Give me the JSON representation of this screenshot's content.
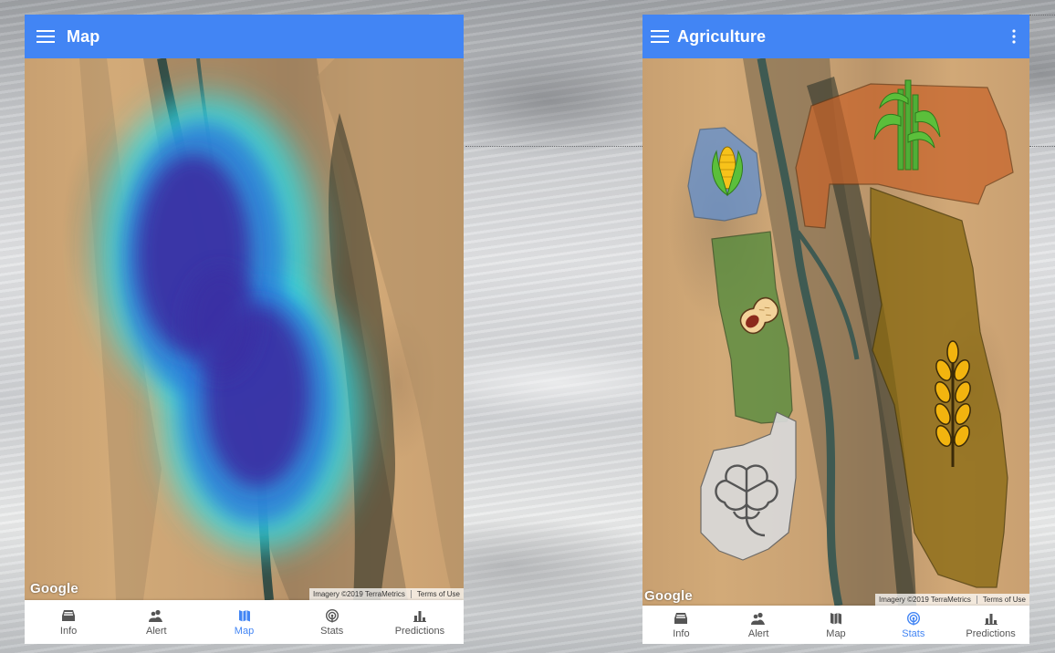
{
  "left_screen": {
    "title": "Map",
    "icons": {
      "menu": "hamburger-menu-icon"
    },
    "map": {
      "logo": "Google",
      "imagery": "Imagery ©2019 TerraMetrics",
      "terms": "Terms of Use",
      "overlay": "heatmap"
    },
    "nav": [
      {
        "label": "Info",
        "icon": "inbox-icon",
        "active": false
      },
      {
        "label": "Alert",
        "icon": "people-icon",
        "active": false
      },
      {
        "label": "Map",
        "icon": "map-icon",
        "active": true
      },
      {
        "label": "Stats",
        "icon": "signal-icon",
        "active": false
      },
      {
        "label": "Predictions",
        "icon": "bar-chart-icon",
        "active": false
      }
    ]
  },
  "right_screen": {
    "title": "Agriculture",
    "icons": {
      "menu": "hamburger-menu-icon",
      "more": "more-vertical-icon"
    },
    "map": {
      "logo": "Google",
      "imagery": "Imagery ©2019 TerraMetrics",
      "terms": "Terms of Use",
      "crop_zones": [
        {
          "crop": "corn-icon",
          "color": "#5b8fd6"
        },
        {
          "crop": "sugarcane-icon",
          "color": "#c8642a"
        },
        {
          "crop": "peanut-icon",
          "color": "#4f8a3a"
        },
        {
          "crop": "wheat-icon",
          "color": "#8a6a12"
        },
        {
          "crop": "cotton-icon",
          "color": "#d9d9d9"
        }
      ]
    },
    "nav": [
      {
        "label": "Info",
        "icon": "inbox-icon",
        "active": false
      },
      {
        "label": "Alert",
        "icon": "people-icon",
        "active": false
      },
      {
        "label": "Map",
        "icon": "map-icon",
        "active": false
      },
      {
        "label": "Stats",
        "icon": "signal-icon",
        "active": true
      },
      {
        "label": "Predictions",
        "icon": "bar-chart-icon",
        "active": false
      }
    ]
  },
  "colors": {
    "appbar": "#4285f4",
    "active_nav": "#4285f4",
    "inactive_nav": "#555555"
  }
}
